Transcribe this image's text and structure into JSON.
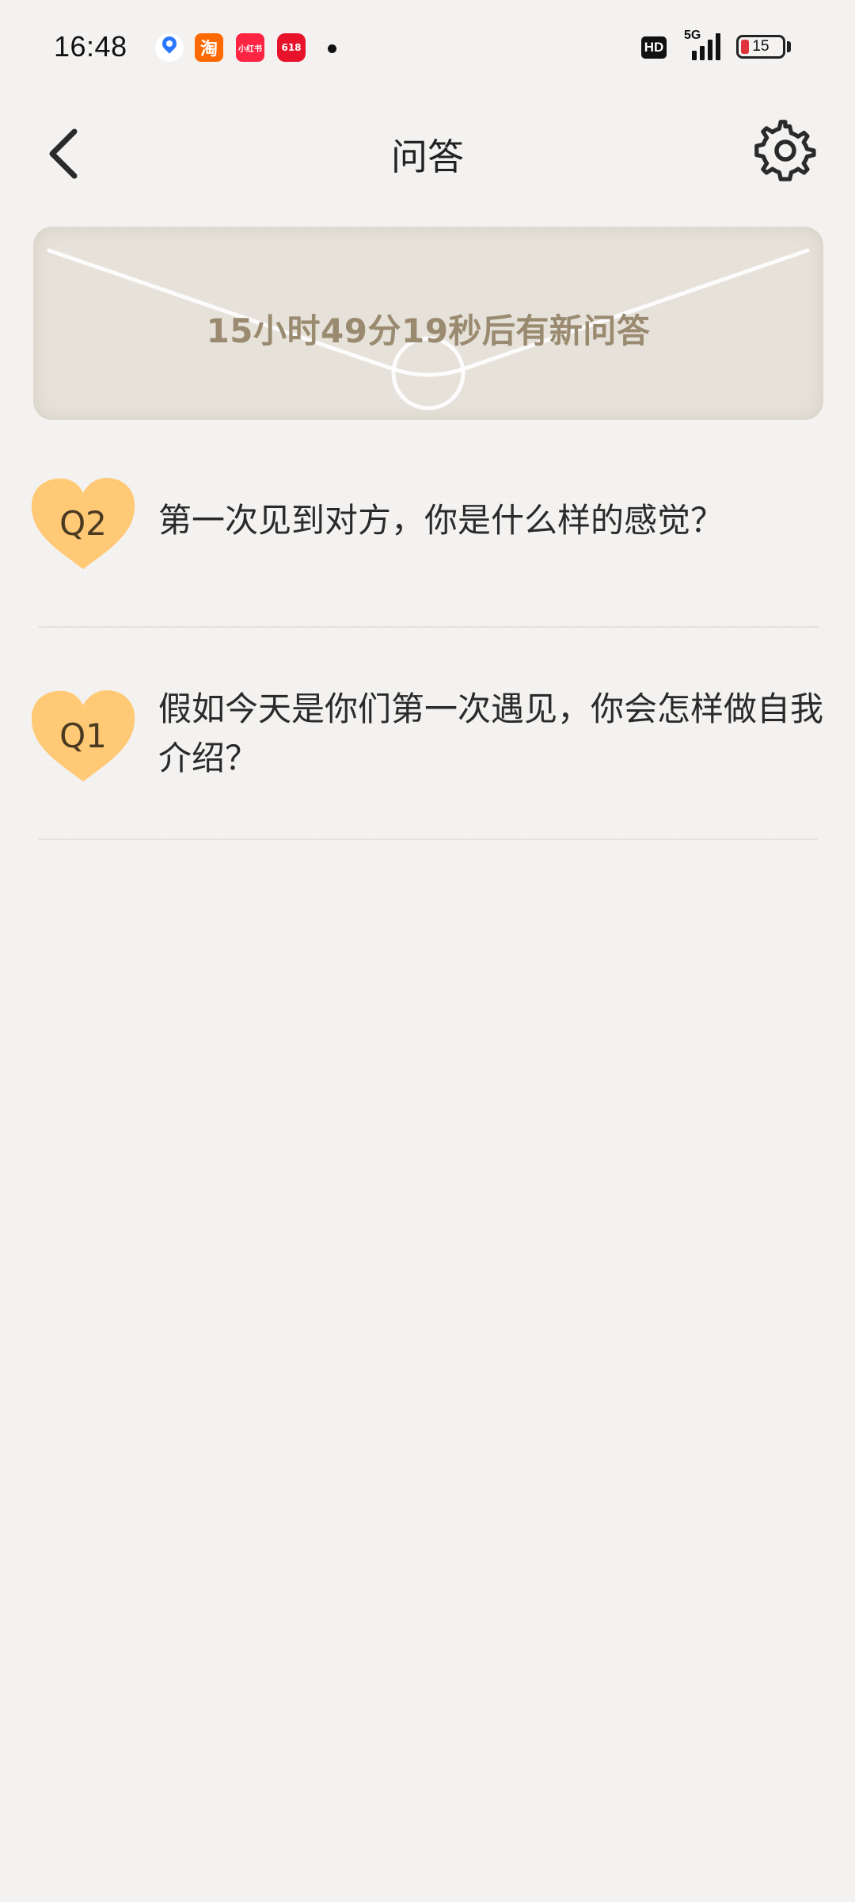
{
  "status_bar": {
    "time": "16:48",
    "notification_icons": [
      "map-icon",
      "taobao-icon",
      "xiaohongshu-icon",
      "618-sale-icon"
    ],
    "taobao_glyph": "淘",
    "xhs_glyph": "小红书",
    "sale_glyph": "618",
    "hd_label": "HD",
    "network_label": "5G",
    "battery_level": "15"
  },
  "header": {
    "title": "问答",
    "back_icon": "chevron-left-icon",
    "settings_icon": "gear-icon"
  },
  "banner": {
    "countdown_text": "15小时49分19秒后有新问答"
  },
  "questions": [
    {
      "badge": "Q2",
      "text": "第一次见到对方，你是什么样的感觉？"
    },
    {
      "badge": "Q1",
      "text": "假如今天是你们第一次遇见，你会怎样做自我介绍？"
    }
  ],
  "colors": {
    "background": "#f4f3f1",
    "banner": "#e6e2da",
    "countdown_text": "#9a8a70",
    "badge_heart": "#ffc66e",
    "divider": "#e4e2de"
  }
}
